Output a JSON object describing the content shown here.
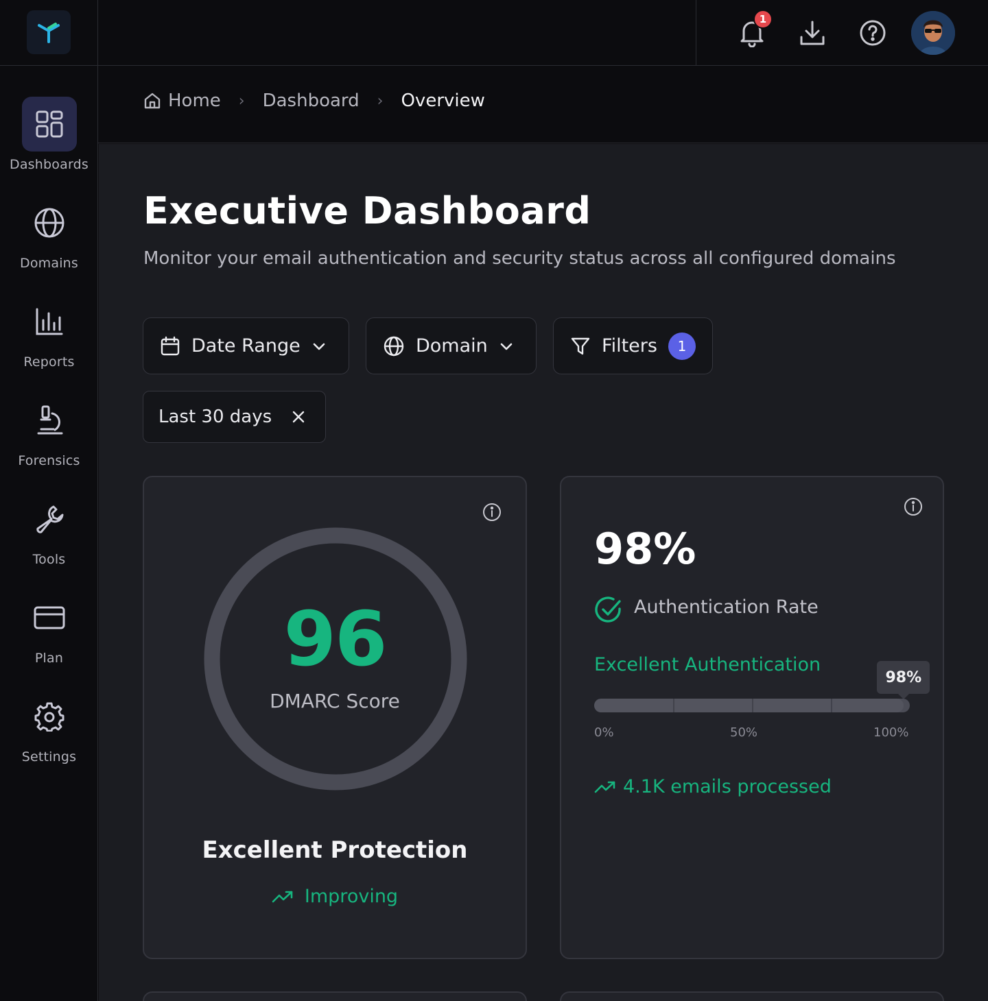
{
  "sidebar": {
    "logo_icon": "trident-logo-icon",
    "items": [
      {
        "label": "Dashboards",
        "icon": "grid-icon",
        "active": true
      },
      {
        "label": "Domains",
        "icon": "globe-icon",
        "active": false
      },
      {
        "label": "Reports",
        "icon": "bar-chart-icon",
        "active": false
      },
      {
        "label": "Forensics",
        "icon": "microscope-icon",
        "active": false
      },
      {
        "label": "Tools",
        "icon": "wrench-icon",
        "active": false
      },
      {
        "label": "Plan",
        "icon": "credit-card-icon",
        "active": false
      },
      {
        "label": "Settings",
        "icon": "gear-icon",
        "active": false
      }
    ]
  },
  "topbar": {
    "notification_count": "1",
    "icons": [
      "bell-icon",
      "download-icon",
      "help-icon",
      "avatar"
    ]
  },
  "breadcrumb": {
    "items": [
      "Home",
      "Dashboard",
      "Overview"
    ]
  },
  "page": {
    "title": "Executive Dashboard",
    "subtitle": "Monitor your email authentication and security status across all configured domains"
  },
  "filters": {
    "date_range_label": "Date Range",
    "domain_label": "Domain",
    "filters_label": "Filters",
    "filters_count": "1",
    "active_chip": "Last 30 days"
  },
  "score_card": {
    "score": "96",
    "score_value": 96,
    "score_label": "DMARC Score",
    "protection": "Excellent Protection",
    "trend": "Improving"
  },
  "auth_card": {
    "rate": "98%",
    "rate_label": "Authentication Rate",
    "status": "Excellent Authentication",
    "tooltip": "98%",
    "rate_value": 0.98,
    "axis": [
      "0%",
      "50%",
      "100%"
    ],
    "emails": "4.1K emails processed"
  },
  "colors": {
    "accent_green": "#17b57f",
    "badge_red": "#e5484d",
    "badge_purple": "#5b61e6",
    "active_nav": "#27294a"
  }
}
